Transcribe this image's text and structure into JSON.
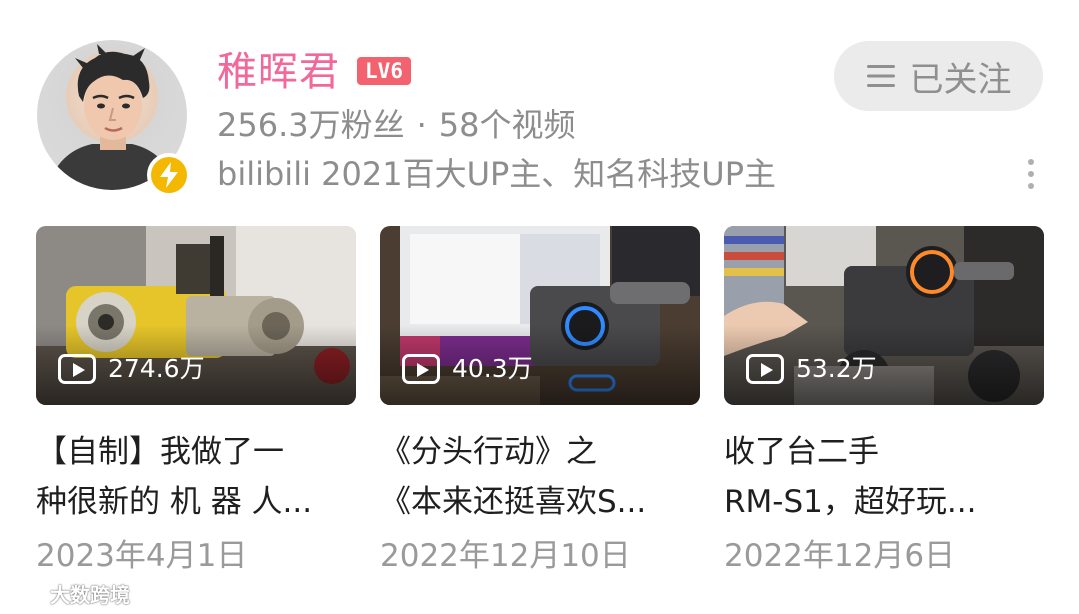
{
  "profile": {
    "name": "稚晖君",
    "level": "LV6",
    "followers": "256.3万粉丝",
    "separator": "·",
    "videos": "58个视频",
    "bio": "bilibili 2021百大UP主、知名科技UP主",
    "follow_button": {
      "icon": "menu-icon",
      "label": "已关注"
    },
    "more_icon": "more-vertical-icon",
    "colors": {
      "name": "#f0699a",
      "level_badge": "#f2636f",
      "verified_badge": "#f5b800",
      "secondary_text": "#8d8d8d",
      "follow_button_bg": "#ebebeb"
    }
  },
  "videos": [
    {
      "views": "274.6万",
      "title_line1": "【自制】我做了一",
      "title_line2": "种很新的 机 器 人...",
      "date": "2023年4月1日"
    },
    {
      "views": "40.3万",
      "title_line1": "《分头行动》之",
      "title_line2": "《本来还挺喜欢S...",
      "date": "2022年12月10日"
    },
    {
      "views": "53.2万",
      "title_line1": "收了台二手",
      "title_line2": "RM-S1，超好玩...",
      "date": "2022年12月6日"
    }
  ],
  "watermark": {
    "text": "大数跨境"
  }
}
